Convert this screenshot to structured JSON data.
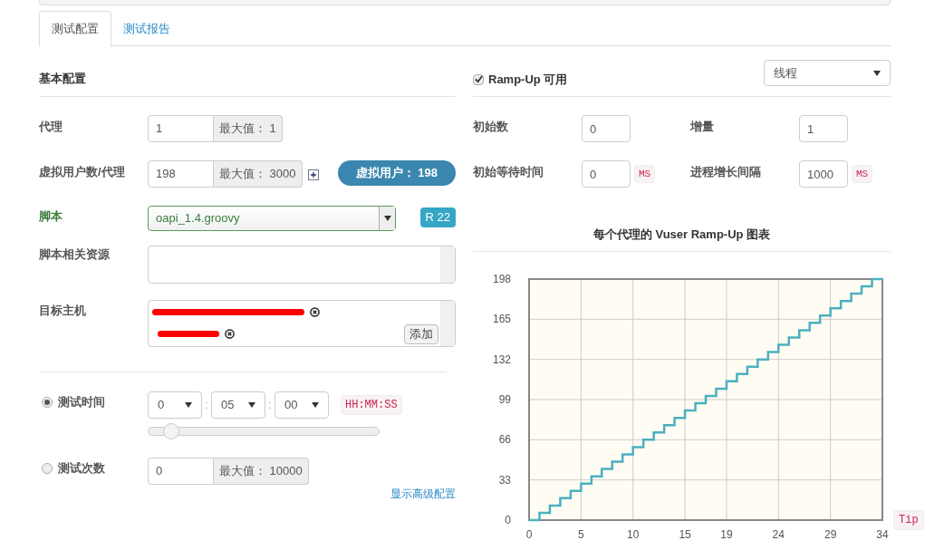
{
  "tabs": [
    {
      "label": "测试配置",
      "selected": true
    },
    {
      "label": "测试报告",
      "selected": false
    }
  ],
  "basic": {
    "title": "基本配置",
    "agent": {
      "label": "代理",
      "value": "1",
      "max": "最大值： 1"
    },
    "vusers": {
      "label": "虚拟用户数/代理",
      "value": "198",
      "max": "最大值： 3000",
      "total": "虚拟用户： 198"
    },
    "script": {
      "label": "脚本",
      "value": "oapi_1.4.groovy",
      "revision": "R 22"
    },
    "resources": {
      "label": "脚本相关资源"
    },
    "target_hosts": {
      "label": "目标主机",
      "hosts": [
        {
          "kind": "redacted"
        },
        {
          "kind": "redacted"
        }
      ],
      "add": "添加"
    },
    "duration": {
      "label": "测试时间",
      "selected": true,
      "hours": "0",
      "minutes": "05",
      "seconds": "00",
      "separator": ":",
      "format": "HH:MM:SS",
      "level": 0.1
    },
    "runs": {
      "label": "测试次数",
      "selected": false,
      "value": "0",
      "max": "最大值： 10000"
    },
    "advanced_link": "显示高级配置"
  },
  "rampup": {
    "label": "Ramp-Up 可用",
    "checked": true,
    "mode": "线程",
    "fields": [
      {
        "label": "初始数",
        "value": "0"
      },
      {
        "label": "增量",
        "value": "1"
      },
      {
        "label": "初始等待时间",
        "value": "0",
        "unit": "MS"
      },
      {
        "label": "进程增长间隔",
        "value": "1000",
        "unit": "MS"
      }
    ],
    "chart_title": "每个代理的 Vuser Ramp-Up 图表",
    "chart_data": {
      "type": "line",
      "grid": true,
      "xlim": [
        0,
        34
      ],
      "ylim": [
        0,
        198
      ],
      "xticks": [
        0,
        5,
        10,
        15,
        19,
        24,
        29,
        34
      ],
      "yticks": [
        0,
        33,
        66,
        99,
        132,
        165,
        198
      ],
      "x": [
        0,
        1,
        1,
        2,
        2,
        3,
        3,
        4,
        4,
        5,
        5,
        6,
        6,
        7,
        7,
        8,
        8,
        9,
        9,
        10,
        10,
        11,
        11,
        12,
        12,
        13,
        13,
        14,
        14,
        15,
        15,
        16,
        16,
        17,
        17,
        18,
        18,
        19,
        19,
        20,
        20,
        21,
        21,
        22,
        22,
        23,
        23,
        24,
        24,
        25,
        25,
        26,
        26,
        27,
        27,
        28,
        28,
        29,
        29,
        30,
        30,
        31,
        31,
        32,
        32,
        33,
        33,
        34
      ],
      "series": [
        {
          "color": "#4ab0c0",
          "values": [
            0,
            0,
            6,
            6,
            12,
            12,
            18,
            18,
            24,
            24,
            30,
            30,
            36,
            36,
            42,
            42,
            48,
            48,
            54,
            54,
            60,
            60,
            66,
            66,
            72,
            72,
            78,
            78,
            84,
            84,
            90,
            90,
            96,
            96,
            102,
            102,
            108,
            108,
            114,
            114,
            120,
            120,
            126,
            126,
            132,
            132,
            138,
            138,
            144,
            144,
            150,
            150,
            156,
            156,
            162,
            162,
            168,
            168,
            174,
            174,
            180,
            180,
            186,
            186,
            192,
            192,
            198,
            198
          ]
        }
      ]
    },
    "tip": "Tip"
  }
}
